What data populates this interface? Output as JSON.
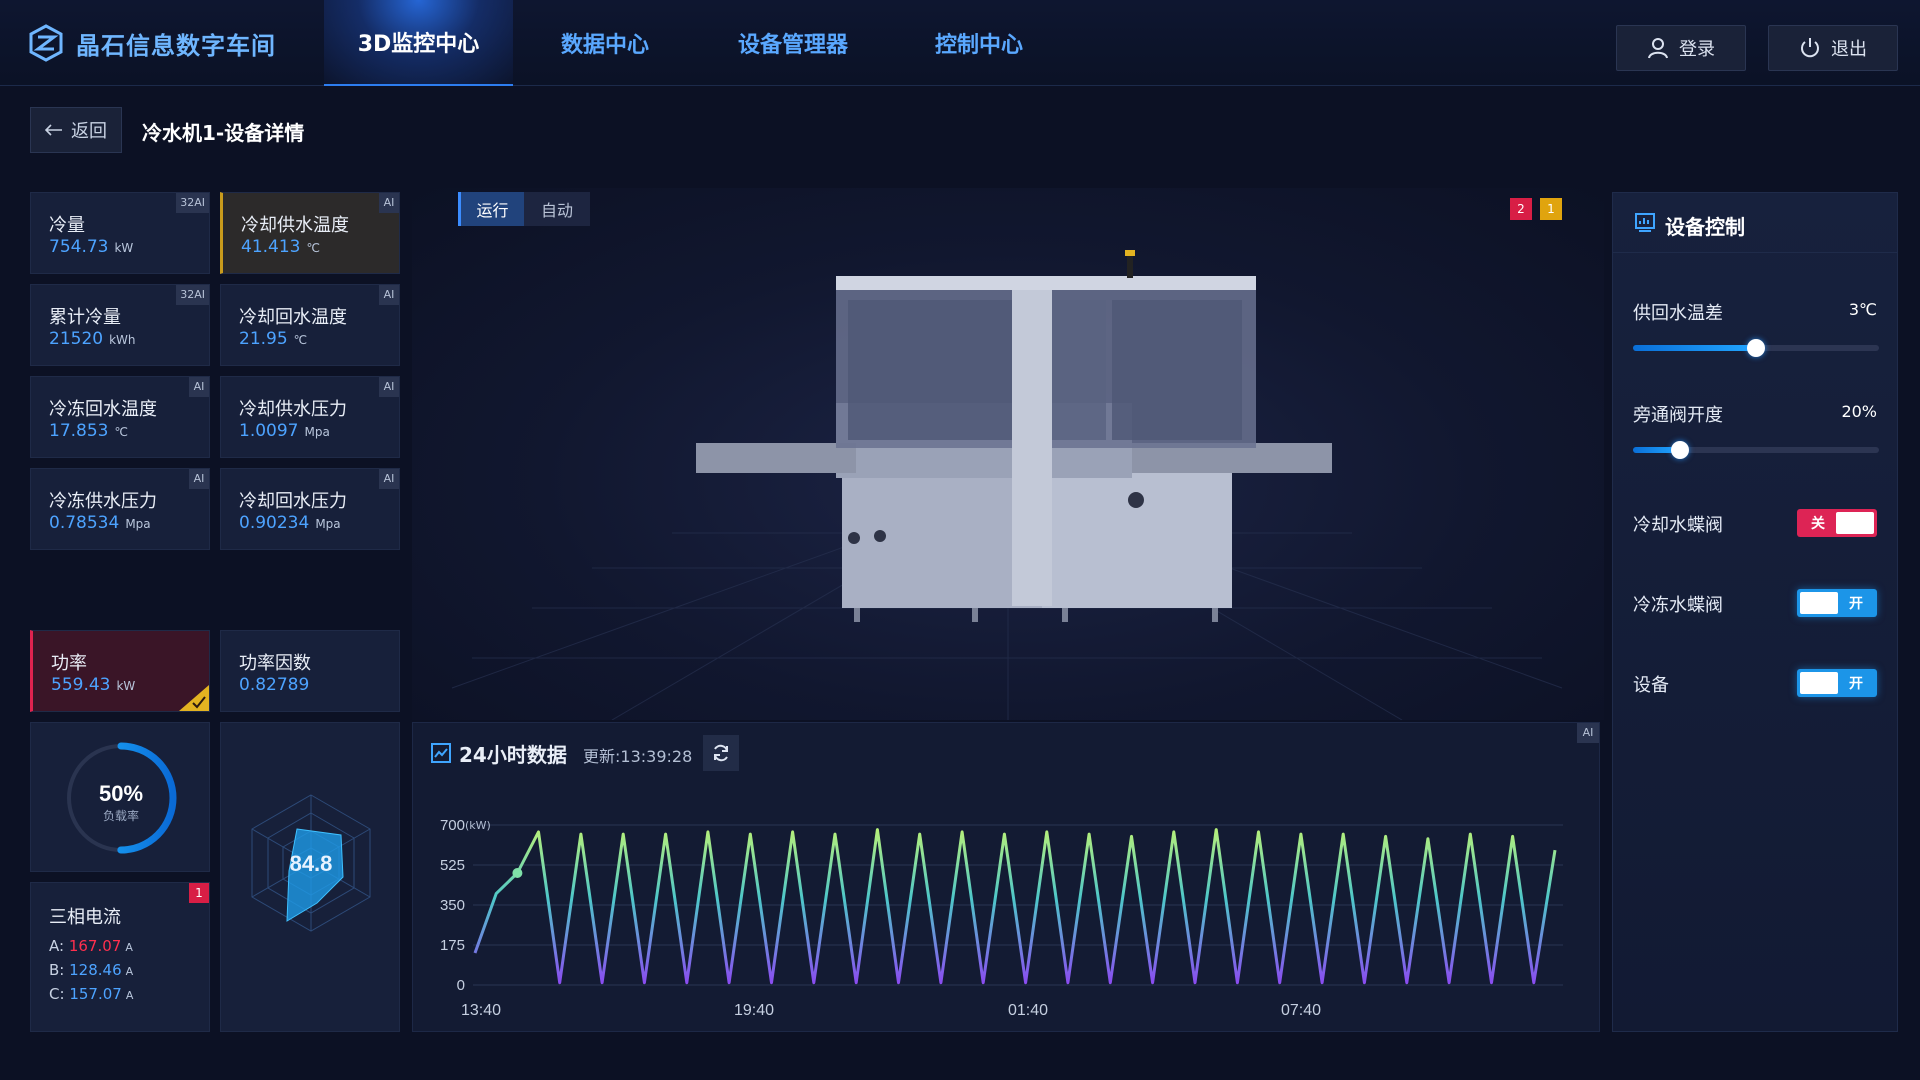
{
  "brand": {
    "name": "晶石信息数字车间",
    "accent": "#6fb6ff"
  },
  "nav": {
    "tabs": [
      {
        "label": "3D监控中心",
        "active": true
      },
      {
        "label": "数据中心",
        "active": false
      },
      {
        "label": "设备管理器",
        "active": false
      },
      {
        "label": "控制中心",
        "active": false
      }
    ],
    "login_label": "登录",
    "logout_label": "退出"
  },
  "breadcrumb": {
    "back_label": "返回",
    "title": "冷水机1-设备详情"
  },
  "metrics": [
    {
      "label": "冷量",
      "value": "754.73",
      "unit": "kW",
      "tag": "32AI"
    },
    {
      "label": "冷却供水温度",
      "value": "41.413",
      "unit": "℃",
      "tag": "AI",
      "state": "warn"
    },
    {
      "label": "累计冷量",
      "value": "21520",
      "unit": "kWh",
      "tag": "32AI"
    },
    {
      "label": "冷却回水温度",
      "value": "21.95",
      "unit": "℃",
      "tag": "AI"
    },
    {
      "label": "冷冻回水温度",
      "value": "17.853",
      "unit": "℃",
      "tag": "AI"
    },
    {
      "label": "冷却供水压力",
      "value": "1.0097",
      "unit": "Mpa",
      "tag": "AI"
    },
    {
      "label": "冷冻供水压力",
      "value": "0.78534",
      "unit": "Mpa",
      "tag": "AI"
    },
    {
      "label": "冷却回水压力",
      "value": "0.90234",
      "unit": "Mpa",
      "tag": "AI"
    }
  ],
  "power": {
    "label": "功率",
    "value": "559.43",
    "unit": "kW",
    "state": "alarm"
  },
  "power_factor": {
    "label": "功率因数",
    "value": "0.82789"
  },
  "load_gauge": {
    "value_text": "50%",
    "label": "负载率",
    "fraction": 0.5
  },
  "radar": {
    "value_text": "84.8"
  },
  "three_phase": {
    "label": "三相电流",
    "badge": "1",
    "phases": [
      {
        "name": "A:",
        "value": "167.07",
        "unit": "A",
        "alert": true
      },
      {
        "name": "B:",
        "value": "128.46",
        "unit": "A",
        "alert": false
      },
      {
        "name": "C:",
        "value": "157.07",
        "unit": "A",
        "alert": false
      }
    ]
  },
  "viewer": {
    "modes": [
      {
        "label": "运行",
        "active": true
      },
      {
        "label": "自动",
        "active": false
      }
    ],
    "alarm_badges": [
      {
        "count": "2",
        "color": "#d81e45"
      },
      {
        "count": "1",
        "color": "#e0a40e"
      }
    ]
  },
  "chart": {
    "title": "24小时数据",
    "update_text": "更新:13:39:28",
    "tag": "AI",
    "chart_data": {
      "type": "line",
      "title": "24小时数据",
      "ylabel": "",
      "yunit": "(kW)",
      "ylim": [
        0,
        700
      ],
      "yticks": [
        "700",
        "525",
        "350",
        "175",
        "0"
      ],
      "xticks": [
        "13:40",
        "19:40",
        "01:40",
        "07:40"
      ],
      "series": [
        {
          "values": [
            140,
            400,
            490,
            670,
            10,
            660,
            10,
            660,
            10,
            660,
            10,
            670,
            10,
            660,
            10,
            670,
            10,
            660,
            10,
            680,
            10,
            660,
            10,
            670,
            10,
            660,
            10,
            670,
            10,
            660,
            10,
            650,
            10,
            670,
            10,
            680,
            10,
            670,
            10,
            660,
            10,
            660,
            10,
            650,
            10,
            640,
            10,
            660,
            10,
            650,
            10,
            590
          ]
        }
      ]
    }
  },
  "control": {
    "title": "设备控制",
    "sliders": [
      {
        "label": "供回水温差",
        "value_text": "3℃",
        "fraction": 0.5
      },
      {
        "label": "旁通阀开度",
        "value_text": "20%",
        "fraction": 0.19
      }
    ],
    "toggles": [
      {
        "label": "冷却水蝶阀",
        "state": "off",
        "text": "关"
      },
      {
        "label": "冷冻水蝶阀",
        "state": "on",
        "text": "开"
      },
      {
        "label": "设备",
        "state": "on",
        "text": "开"
      }
    ]
  }
}
